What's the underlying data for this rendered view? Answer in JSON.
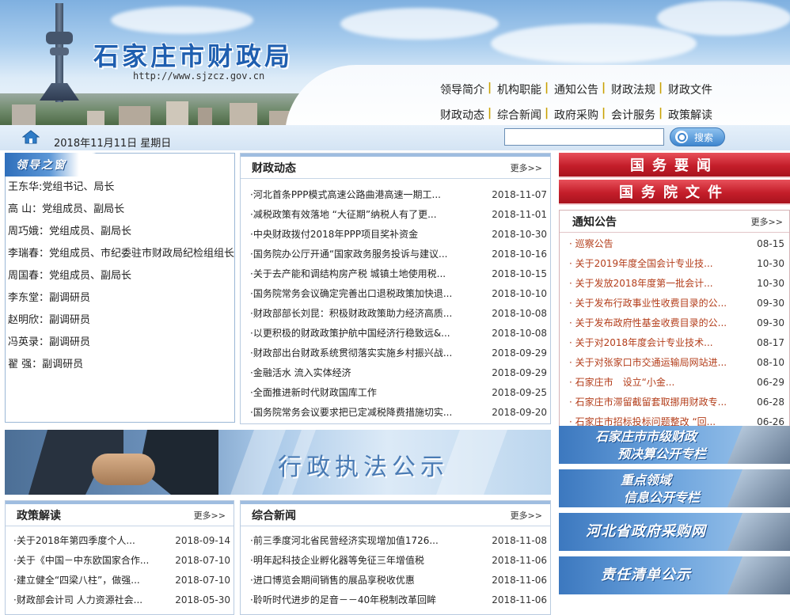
{
  "header": {
    "title": "石家庄市财政局",
    "url": "http://www.sjzcz.gov.cn",
    "nav_row1": [
      "领导简介",
      "机构职能",
      "通知公告",
      "财政法规",
      "财政文件"
    ],
    "nav_row2": [
      "财政动态",
      "综合新闻",
      "政府采购",
      "会计服务",
      "政策解读"
    ]
  },
  "bar": {
    "date": "2018年11月11日 星期日",
    "search_value": "",
    "search_button": "搜索"
  },
  "leaders": {
    "title": "领导之窗",
    "items": [
      "王东华:党组书记、局长",
      "高 山：党组成员、副局长",
      "周巧娥：党组成员、副局长",
      "李瑞春：党组成员、市纪委驻市财政局纪检组组长",
      "周国春：党组成员、副局长",
      "李东堂：副调研员",
      "赵明欣：副调研员",
      "冯英录：副调研员",
      "翟 强：副调研员"
    ]
  },
  "finance_news": {
    "title": "财政动态",
    "more": "更多>>",
    "items": [
      {
        "title": "·河北首条PPP模式高速公路曲港高速一期工...",
        "date": "2018-11-07"
      },
      {
        "title": "·减税政策有效落地 “大征期”纳税人有了更...",
        "date": "2018-11-01"
      },
      {
        "title": "·中央财政拨付2018年PPP项目奖补资金",
        "date": "2018-10-30"
      },
      {
        "title": "·国务院办公厅开通“国家政务服务投诉与建议...",
        "date": "2018-10-16"
      },
      {
        "title": "·关于去产能和调结构房产税 城镇土地使用税...",
        "date": "2018-10-15"
      },
      {
        "title": "·国务院常务会议确定完善出口退税政策加快退...",
        "date": "2018-10-10"
      },
      {
        "title": "·财政部部长刘昆：积极财政政策助力经济高质...",
        "date": "2018-10-08"
      },
      {
        "title": "·以更积极的财政政策护航中国经济行稳致远&...",
        "date": "2018-10-08"
      },
      {
        "title": "·财政部出台财政系统贯彻落实实施乡村振兴战...",
        "date": "2018-09-29"
      },
      {
        "title": "·金融活水 流入实体经济",
        "date": "2018-09-29"
      },
      {
        "title": "·全面推进新时代财政国库工作",
        "date": "2018-09-25"
      },
      {
        "title": "·国务院常务会议要求把已定减税降费措施切实...",
        "date": "2018-09-20"
      }
    ]
  },
  "right_banners": {
    "state_affairs": "国务要闻",
    "state_council_docs": "国务院文件"
  },
  "notices": {
    "title": "通知公告",
    "more": "更多>>",
    "items": [
      {
        "title": "巡察公告",
        "date": "08-15"
      },
      {
        "title": "关于2019年度全国会计专业技...",
        "date": "10-30"
      },
      {
        "title": "关于发放2018年度第一批会计...",
        "date": "10-30"
      },
      {
        "title": "关于发布行政事业性收费目录的公...",
        "date": "09-30"
      },
      {
        "title": "关于发布政府性基金收费目录的公...",
        "date": "09-30"
      },
      {
        "title": "关于对2018年度会计专业技术...",
        "date": "08-17"
      },
      {
        "title": "关于对张家口市交通运输局网站进...",
        "date": "08-10"
      },
      {
        "title": "石家庄市　设立“小金...",
        "date": "06-29"
      },
      {
        "title": "石家庄市滞留截留套取挪用财政专...",
        "date": "06-28"
      },
      {
        "title": "石家庄市招标投标问题整改 “回...",
        "date": "06-26"
      }
    ]
  },
  "law_banner": {
    "title": "行政执法公示"
  },
  "blue_banners": [
    {
      "line1": "石家庄市市级财政",
      "line2": "预决算公开专栏"
    },
    {
      "line1": "重点领域",
      "line2": "信息公开专栏"
    },
    {
      "line1": "河北省政府采购网",
      "line2": ""
    },
    {
      "line1": "责任清单公示",
      "line2": ""
    }
  ],
  "policy": {
    "title": "政策解读",
    "more": "更多>>",
    "items": [
      {
        "title": "·关于2018年第四季度个人...",
        "date": "2018-09-14"
      },
      {
        "title": "·关于《中国－中东欧国家合作...",
        "date": "2018-07-10"
      },
      {
        "title": "·建立健全“四梁八柱”，做强...",
        "date": "2018-07-10"
      },
      {
        "title": "·财政部会计司 人力资源社会...",
        "date": "2018-05-30"
      }
    ]
  },
  "general_news": {
    "title": "综合新闻",
    "more": "更多>>",
    "items": [
      {
        "title": "·前三季度河北省民营经济实现增加值1726...",
        "date": "2018-11-08"
      },
      {
        "title": "·明年起科技企业孵化器等免征三年增值税",
        "date": "2018-11-06"
      },
      {
        "title": "·进口博览会期间销售的展品享税收优惠",
        "date": "2018-11-06"
      },
      {
        "title": "·聆听时代进步的足音－－40年税制改革回眸",
        "date": "2018-11-06"
      }
    ]
  }
}
